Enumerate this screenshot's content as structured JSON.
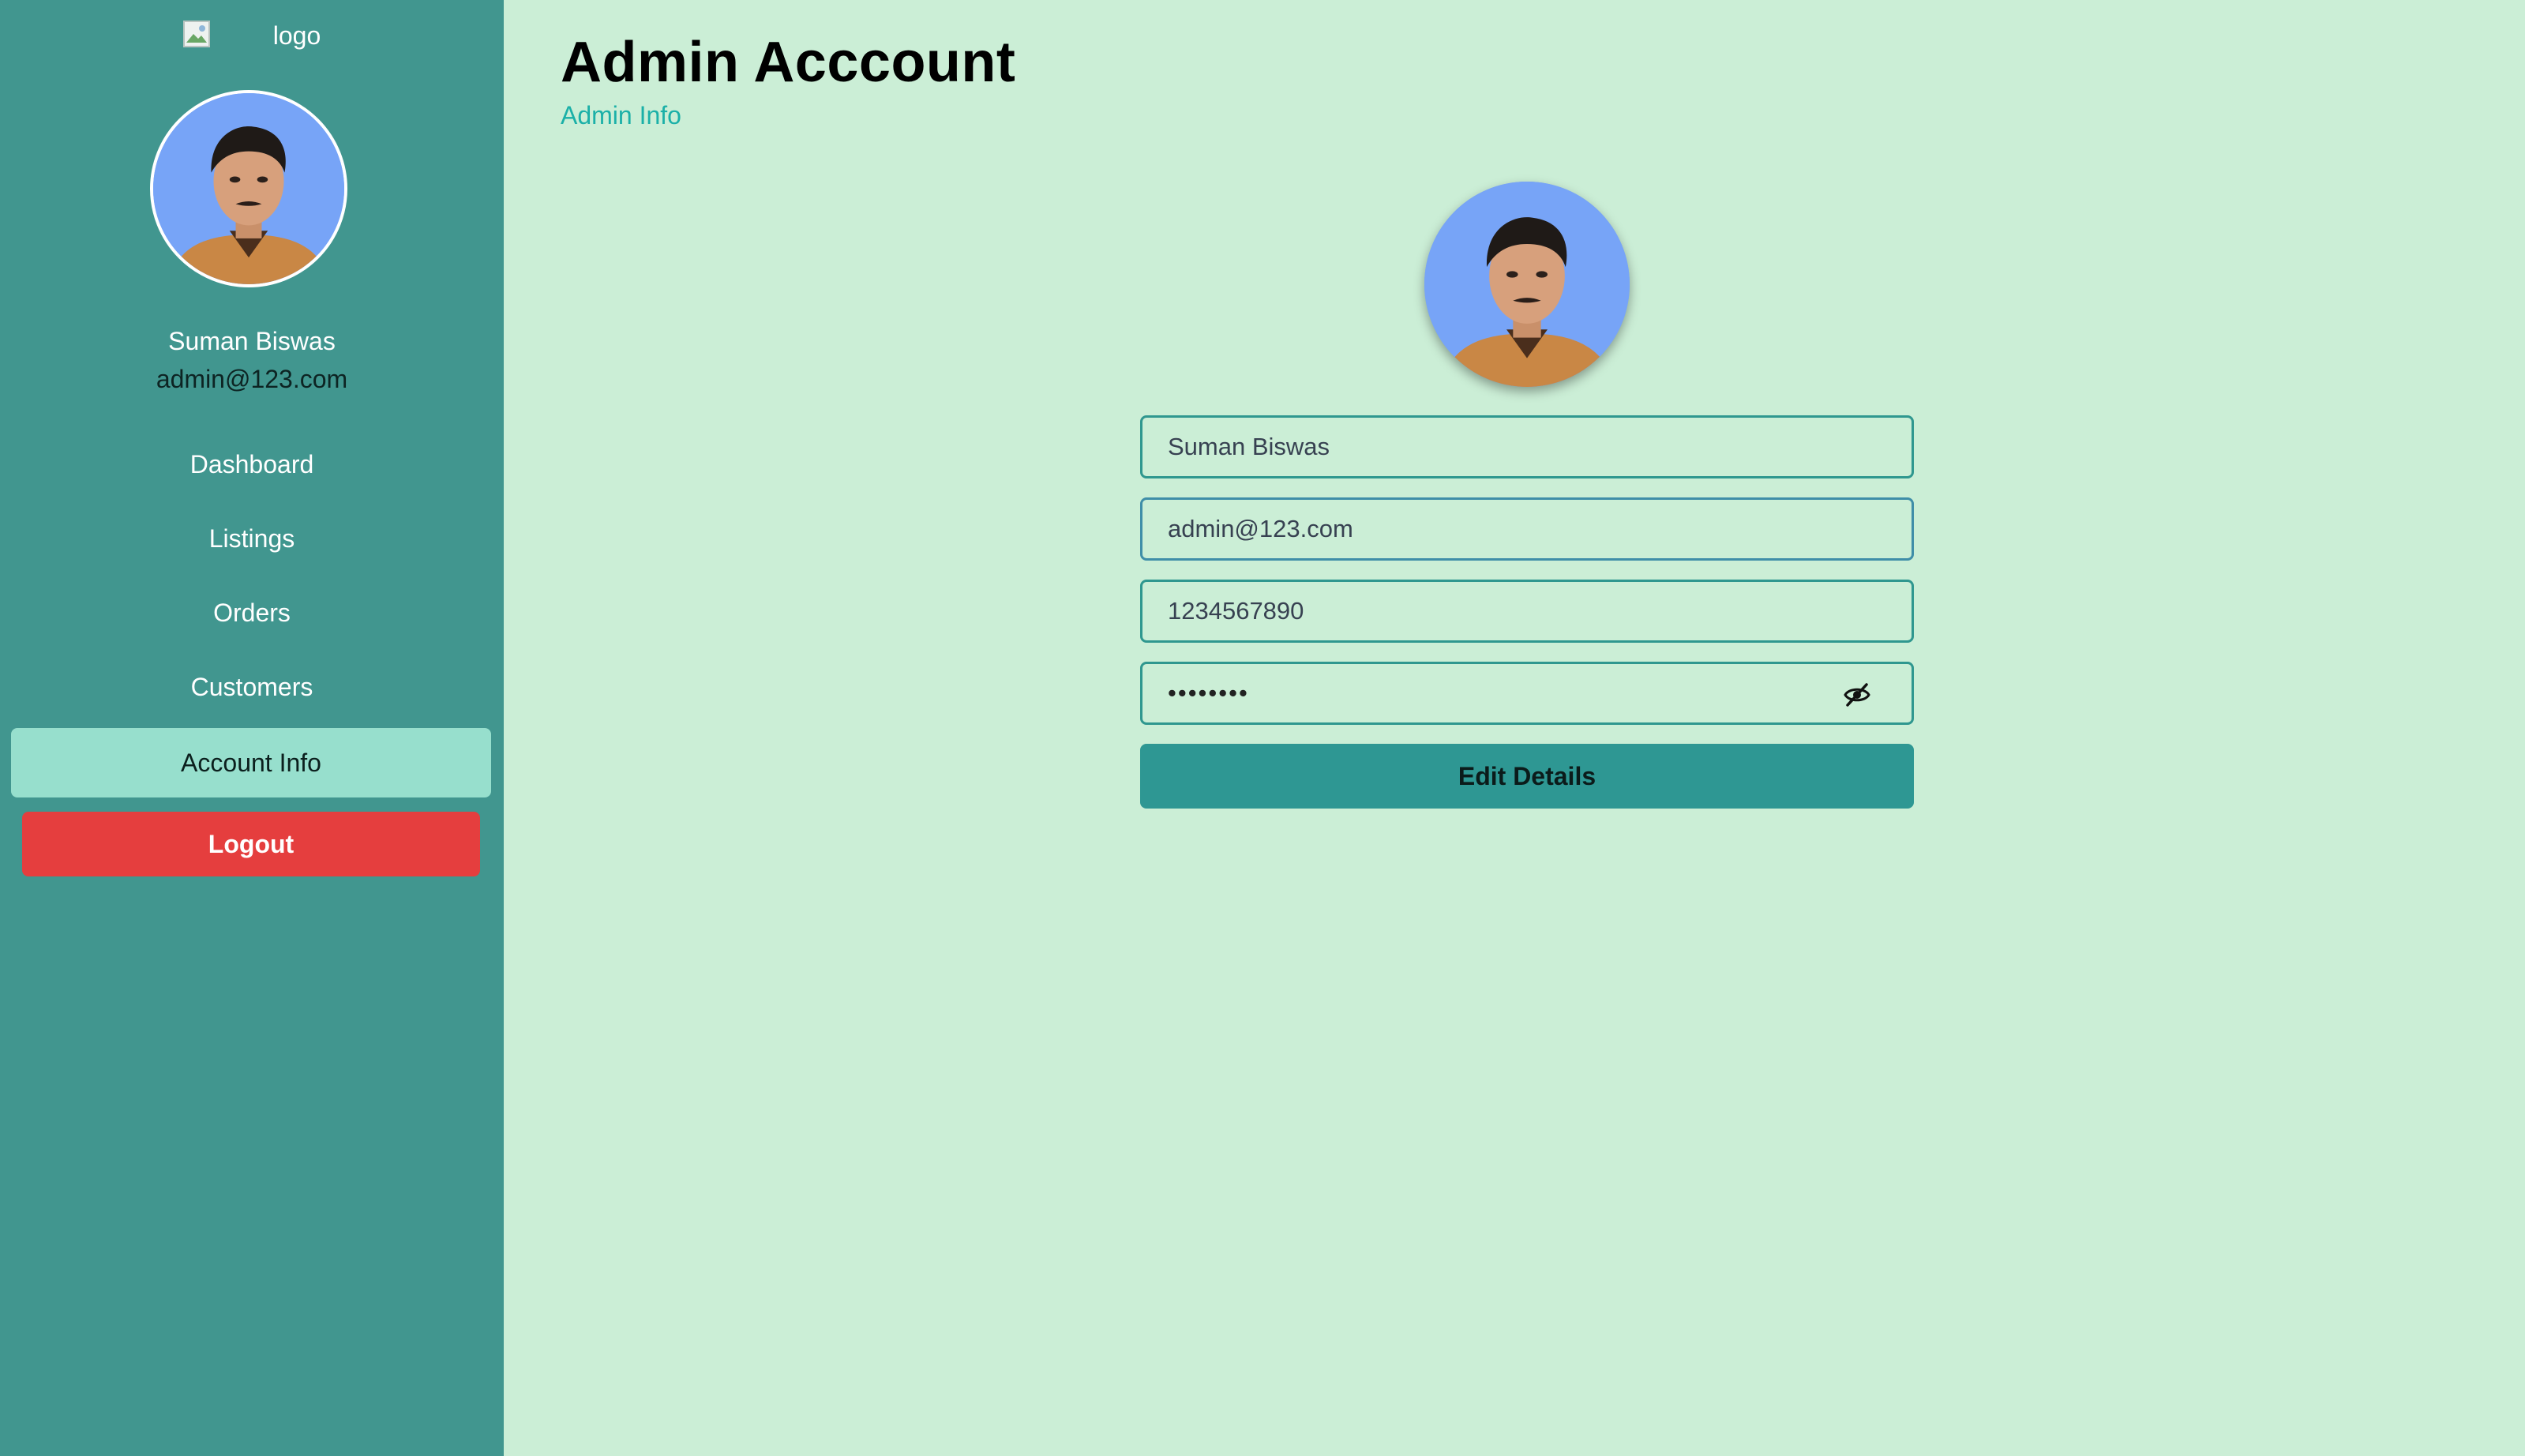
{
  "sidebar": {
    "logo_alt": "logo",
    "user_name": "Suman Biswas",
    "user_email": "admin@123.com",
    "nav": [
      {
        "label": "Dashboard"
      },
      {
        "label": "Listings"
      },
      {
        "label": "Orders"
      },
      {
        "label": "Customers"
      },
      {
        "label": "Account Info",
        "active": true
      }
    ],
    "logout_label": "Logout"
  },
  "main": {
    "title": "Admin Acccount",
    "subtitle": "Admin Info",
    "form": {
      "name": "Suman Biswas",
      "email": "admin@123.com",
      "phone": "1234567890",
      "password_masked": "••••••••",
      "password_toggle_icon": "eye-slash-icon",
      "edit_label": "Edit Details"
    }
  },
  "colors": {
    "sidebar_bg": "#41968f",
    "page_bg": "#cbeed6",
    "active_nav_bg": "#97dfcd",
    "logout_bg": "#e53e3e",
    "primary_button": "#2e9793",
    "subtitle_text": "#1bb0a8"
  }
}
